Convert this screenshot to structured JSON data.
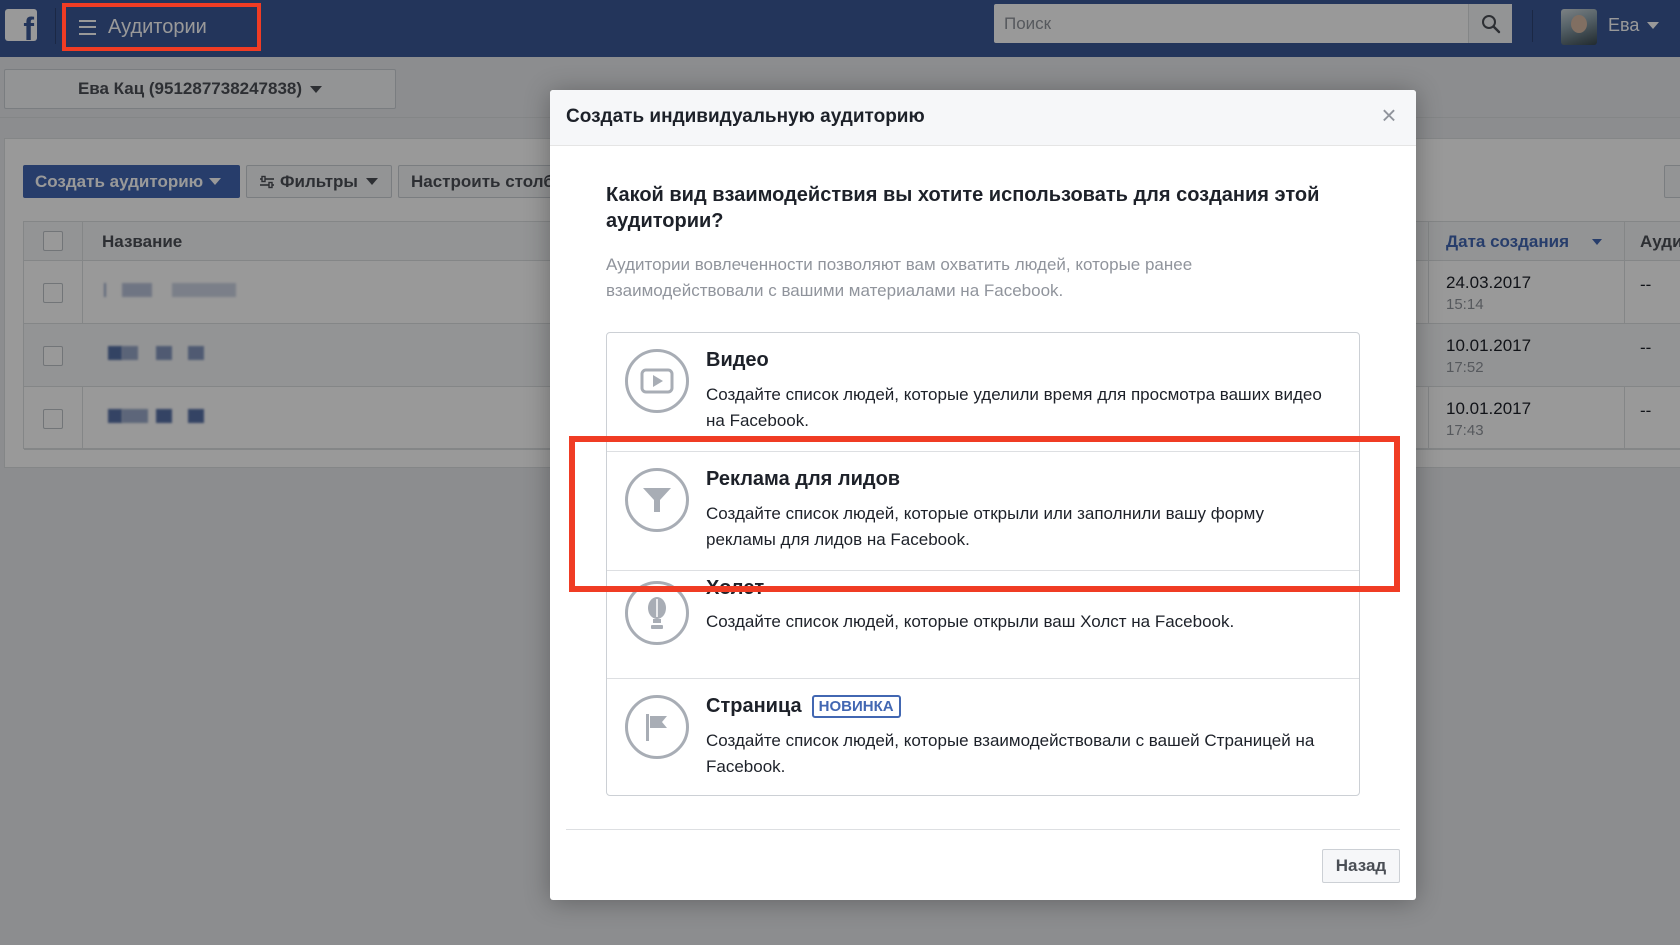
{
  "topbar": {
    "logo_letter": "f",
    "menu_title": "Аудитории",
    "search_placeholder": "Поиск",
    "user_name": "Ева"
  },
  "account": {
    "label": "Ева Кац (951287738247838)"
  },
  "toolbar": {
    "create_label": "Создать аудиторию",
    "filters_label": "Фильтры",
    "columns_label": "Настроить столбцы"
  },
  "table": {
    "headers": {
      "name": "Название",
      "date": "Дата создания",
      "audience": "Ауди"
    },
    "rows": [
      {
        "date": "24.03.2017",
        "time": "15:14",
        "audience": "--"
      },
      {
        "date": "10.01.2017",
        "time": "17:52",
        "audience": "--"
      },
      {
        "date": "10.01.2017",
        "time": "17:43",
        "audience": "--"
      }
    ]
  },
  "modal": {
    "title": "Создать индивидуальную аудиторию",
    "close": "×",
    "question": "Какой вид взаимодействия вы хотите использовать для создания этой аудитории?",
    "description": "Аудитории вовлеченности позволяют вам охватить людей, которые ранее взаимодействовали с вашими материалами на Facebook.",
    "options": [
      {
        "icon": "video-play-icon",
        "title": "Видео",
        "text": "Создайте список людей, которые уделили время для просмотра ваших видео на Facebook."
      },
      {
        "icon": "funnel-icon",
        "title": "Реклама для лидов",
        "text": "Создайте список людей, которые открыли или заполнили вашу форму рекламы для лидов на Facebook."
      },
      {
        "icon": "canvas-icon",
        "title": "Холст",
        "text": "Создайте список людей, которые открыли ваш Холст на Facebook."
      },
      {
        "icon": "page-flag-icon",
        "title": "Страница",
        "badge": "НОВИНКА",
        "text": "Создайте список людей, которые взаимодействовали с вашей Страницей на Facebook."
      }
    ],
    "back_label": "Назад"
  },
  "colors": {
    "fb_blue": "#3b5998",
    "button_blue": "#4267b2",
    "highlight_red": "#f03c24"
  }
}
